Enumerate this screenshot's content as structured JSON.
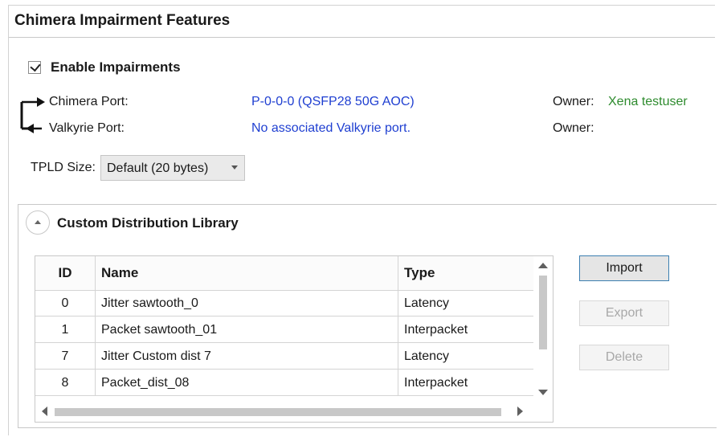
{
  "header": {
    "title": "Chimera Impairment Features"
  },
  "enable": {
    "label": "Enable Impairments",
    "checked": true
  },
  "ports": {
    "chimera": {
      "label": "Chimera Port:",
      "value": "P-0-0-0 (QSFP28 50G AOC)",
      "owner_label": "Owner:",
      "owner_value": "Xena testuser"
    },
    "valkyrie": {
      "label": "Valkyrie Port:",
      "value": "No associated Valkyrie port.",
      "owner_label": "Owner:",
      "owner_value": ""
    }
  },
  "tpld": {
    "label": "TPLD Size:",
    "selected": "Default (20 bytes)"
  },
  "library": {
    "title": "Custom Distribution Library",
    "columns": {
      "id": "ID",
      "name": "Name",
      "type": "Type"
    },
    "rows": [
      {
        "id": "0",
        "name": "Jitter sawtooth_0",
        "type": "Latency"
      },
      {
        "id": "1",
        "name": "Packet sawtooth_01",
        "type": "Interpacket"
      },
      {
        "id": "7",
        "name": "Jitter Custom dist 7",
        "type": "Latency"
      },
      {
        "id": "8",
        "name": "Packet_dist_08",
        "type": "Interpacket"
      }
    ],
    "buttons": {
      "import": "Import",
      "export": "Export",
      "delete": "Delete"
    }
  },
  "colors": {
    "link": "#1f3fd1",
    "owner": "#2e8b2e",
    "accent_border": "#3c7fb1"
  },
  "icons": {
    "checkbox": "check-icon",
    "collapse": "chevron-up-icon",
    "dropdown": "chevron-down-icon",
    "port_link": "bracket-arrow-icon"
  }
}
